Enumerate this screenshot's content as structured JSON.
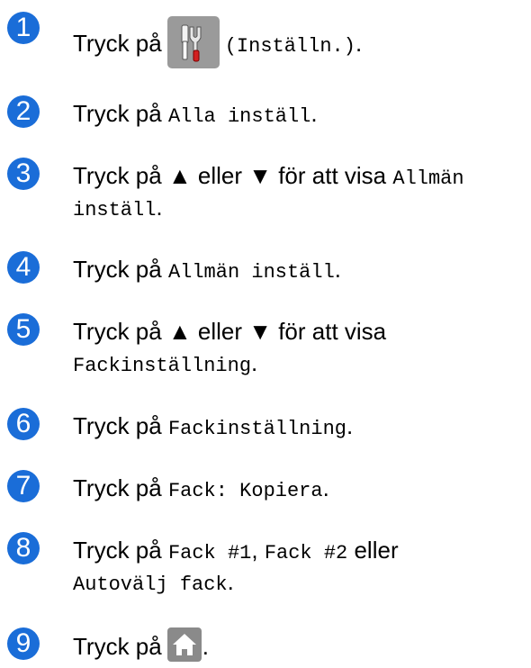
{
  "steps": [
    {
      "number": "1",
      "parts": [
        "Tryck på",
        "(Inställn.)",
        "."
      ]
    },
    {
      "number": "2",
      "parts": [
        "Tryck på ",
        "Alla inställ",
        "."
      ]
    },
    {
      "number": "3",
      "parts": [
        "Tryck på ▲ eller ▼ för att visa ",
        "Allmän",
        "inställ",
        "."
      ]
    },
    {
      "number": "4",
      "parts": [
        "Tryck på ",
        "Allmän inställ",
        "."
      ]
    },
    {
      "number": "5",
      "parts": [
        "Tryck på ▲ eller ▼ för att visa",
        "Fackinställning",
        "."
      ]
    },
    {
      "number": "6",
      "parts": [
        "Tryck på ",
        "Fackinställning",
        "."
      ]
    },
    {
      "number": "7",
      "parts": [
        "Tryck på ",
        "Fack: Kopiera",
        "."
      ]
    },
    {
      "number": "8",
      "parts": [
        "Tryck på ",
        "Fack #1",
        ", ",
        "Fack #2",
        " eller",
        "Autovälj fack",
        "."
      ]
    },
    {
      "number": "9",
      "parts": [
        "Tryck på",
        "."
      ]
    }
  ],
  "icons": {
    "settings_button": "settings-tools-icon",
    "home_button": "home-icon"
  },
  "colors": {
    "step_badge": "#1a6dd8",
    "button_bg": "#9a9a9a"
  }
}
